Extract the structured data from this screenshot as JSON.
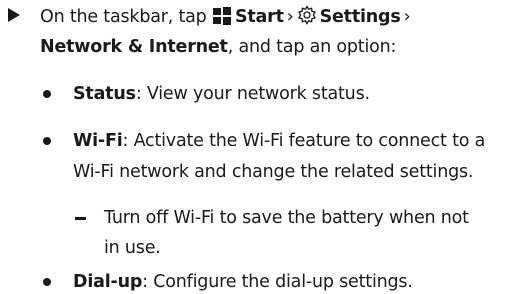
{
  "step": {
    "prefix": "On the taskbar, tap",
    "start_label": "Start",
    "settings_label": "Settings",
    "separator": "›",
    "network_label": "Network & Internet",
    "suffix": ", and tap an option:",
    "start_icon": "windows-start-icon",
    "settings_icon": "gear-icon"
  },
  "options": [
    {
      "name": "Status",
      "lines": [
        ": View your network status."
      ]
    },
    {
      "name": "Wi-Fi",
      "lines": [
        ": Activate the Wi-Fi feature to connect to a",
        "Wi-Fi network and change the related settings."
      ],
      "sub": {
        "lines": [
          "Turn off Wi-Fi to save the battery when not",
          "in use."
        ]
      }
    },
    {
      "name": "Dial-up",
      "lines": [
        ": Configure the dial-up settings."
      ]
    }
  ]
}
